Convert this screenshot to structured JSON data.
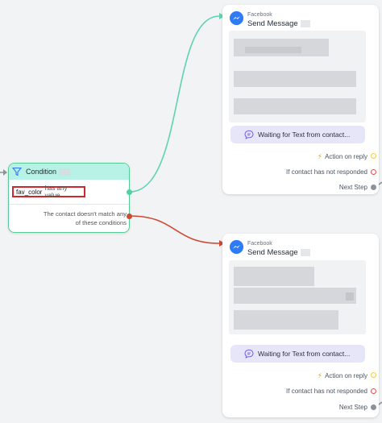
{
  "condition_node": {
    "title": "Condition",
    "rule": {
      "field": "fav_color",
      "operator": "has any value"
    },
    "else_text_line1": "The contact doesn't match any",
    "else_text_line2": "of these conditions"
  },
  "message_nodes": [
    {
      "channel": "Facebook",
      "title": "Send Message",
      "waiting_label": "Waiting for Text from contact...",
      "outputs": {
        "action_label": "Action on reply",
        "no_response_label": "If contact has not responded",
        "next_label": "Next Step"
      }
    },
    {
      "channel": "Facebook",
      "title": "Send Message",
      "waiting_label": "Waiting for Text from contact...",
      "outputs": {
        "action_label": "Action on reply",
        "no_response_label": "If contact has not responded",
        "next_label": "Next Step"
      }
    }
  ],
  "colors": {
    "canvas": "#f2f3f5",
    "condition_border": "#57cc99",
    "condition_header": "#b8f2e6",
    "rule_highlight": "#d1262b",
    "match_edge": "#5fd3b0",
    "else_edge": "#cf4a35",
    "messenger_blue": "#2f7bf5",
    "waiting_chip": "#e7e6f9"
  },
  "icons": {
    "condition": "filter-icon",
    "channel": "messenger-icon",
    "waiting": "chat-bubble-icon",
    "action": "lightning-icon"
  }
}
